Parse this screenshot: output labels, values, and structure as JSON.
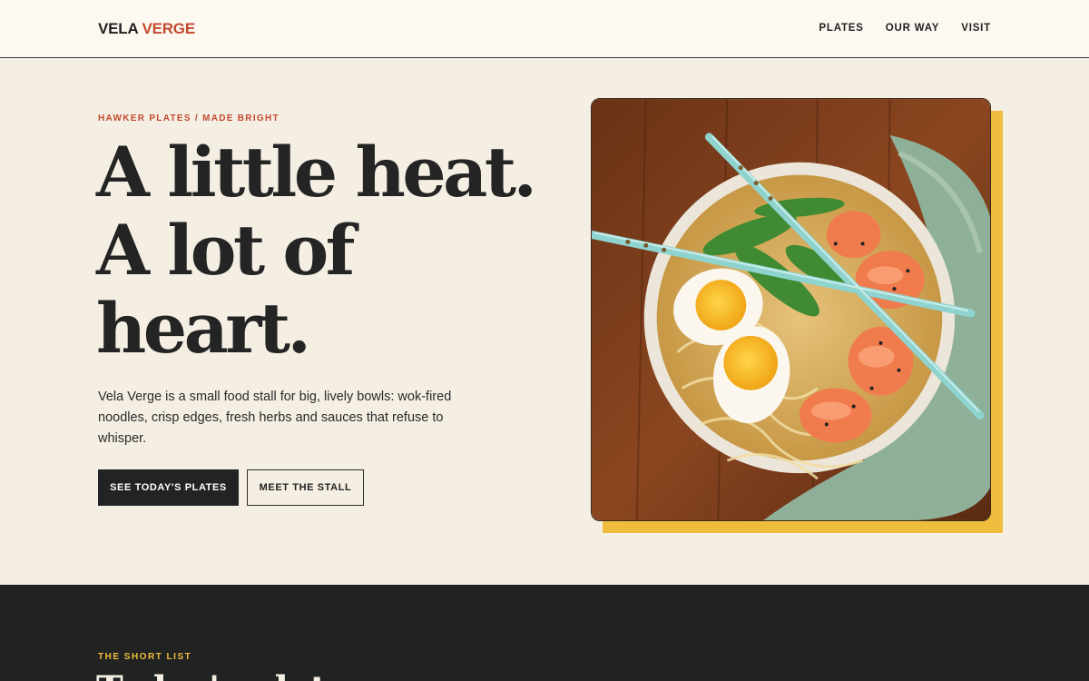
{
  "header": {
    "logo_part1": "VELA",
    "logo_part2": "VERGE",
    "nav": [
      "PLATES",
      "OUR WAY",
      "VISIT"
    ]
  },
  "hero": {
    "eyebrow": "HAWKER PLATES / MADE BRIGHT",
    "headline_lines": [
      "A little heat.",
      "A lot of",
      "heart."
    ],
    "intro": "Vela Verge is a small food stall for big, lively bowls: wok-fired noodles, crisp edges, fresh herbs and sauces that refuse to whisper.",
    "primary_button": "SEE TODAY'S PLATES",
    "secondary_button": "MEET THE STALL"
  },
  "next_section": {
    "eyebrow": "THE SHORT LIST",
    "title": "Today's plates"
  },
  "colors": {
    "accent": "#c2482f",
    "gold": "#efbd3d",
    "dark": "#212322",
    "cream": "#f5efe3"
  }
}
